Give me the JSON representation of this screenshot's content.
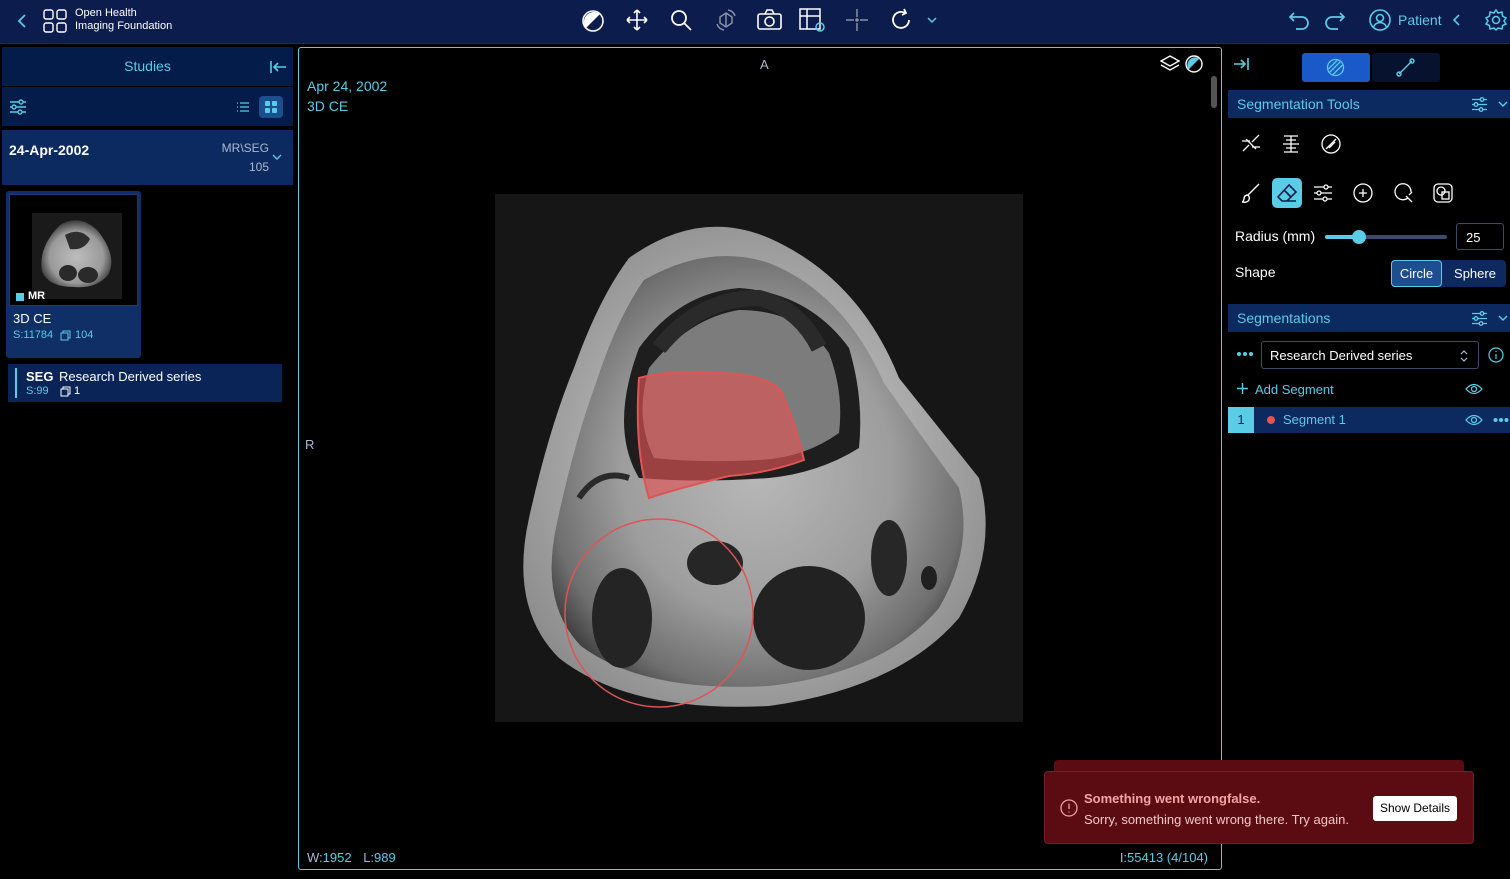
{
  "header": {
    "logo_line1": "Open Health",
    "logo_line2": "Imaging Foundation",
    "patient_label": "Patient"
  },
  "left_panel": {
    "tab_label": "Studies",
    "study": {
      "date": "24-Apr-2002",
      "modalities": "MR\\SEG",
      "instance_count": "105"
    },
    "thumbnail": {
      "modality": "MR",
      "description": "3D CE",
      "series_number": "S:11784",
      "instances": "104"
    },
    "derived_series": {
      "modality": "SEG",
      "description": "Research Derived series",
      "series_number": "S:99",
      "instances": "1"
    }
  },
  "viewport": {
    "orientation_top": "A",
    "orientation_left": "R",
    "study_date": "Apr 24, 2002",
    "series_description": "3D CE",
    "window_label": "W:",
    "window_value": "1952",
    "level_label": "L:",
    "level_value": "989",
    "instance_label": "I:",
    "instance_value": "55413 (4/104)"
  },
  "right_panel": {
    "tools_title": "Segmentation Tools",
    "radius_label": "Radius (mm)",
    "radius_value": "25",
    "radius_fraction": 0.28,
    "shape_label": "Shape",
    "shape_options": [
      "Circle",
      "Sphere"
    ],
    "shape_selected": "Circle",
    "segmentations_title": "Segmentations",
    "segmentation_selected": "Research Derived series",
    "add_segment_label": "Add Segment",
    "segments": [
      {
        "index": "1",
        "label": "Segment 1",
        "color": "#e05454"
      }
    ]
  },
  "toast": {
    "title": "Something went wrongfalse.",
    "message": "Sorry, something went wrong there. Try again.",
    "button_label": "Show Details"
  },
  "colors": {
    "accent": "#5acce6",
    "header_bg": "#0c1c4d",
    "error_bg": "#5b0b12",
    "segment_color": "#e05454"
  }
}
